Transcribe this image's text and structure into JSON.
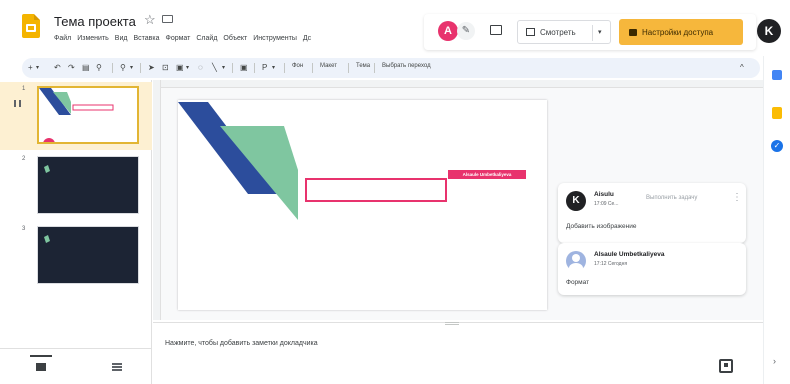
{
  "header": {
    "doc_title": "Тема проекта",
    "star_icon": "star-outline-icon",
    "folder_icon": "folder-icon",
    "menu": [
      "Файл",
      "Изменить",
      "Вид",
      "Вставка",
      "Формат",
      "Слайд",
      "Объект",
      "Инструменты",
      "Дс"
    ],
    "collab_avatar_letter": "A",
    "collab_avatar_color": "#e8336d",
    "present_label": "Смотреть",
    "share_label": "Настройки доступа",
    "share_color": "#f6b73c",
    "account_letter": "K"
  },
  "toolbar": {
    "background_label": "Фон",
    "theme_label": "Макет",
    "layout_label": "Тема",
    "transition_label": "Выбрать переход"
  },
  "filmstrip": {
    "slides": [
      {
        "number": "1"
      },
      {
        "number": "2"
      },
      {
        "number": "3"
      }
    ]
  },
  "canvas": {
    "user_tag": "Alsaule Umbetkaliyeva",
    "shape_colors": {
      "dark_blue": "#2c4d9c",
      "green": "#7fc6a0",
      "pink": "#e8336d"
    }
  },
  "comments": [
    {
      "avatar_letter": "K",
      "avatar_color": "#202124",
      "name": "Aisulu",
      "time": "17:09 Се...",
      "accept_label": "Выполнить задачу",
      "text": "Добавить изображение"
    },
    {
      "avatar_letter": "",
      "avatar_color": "#9fb4e0",
      "name": "Alsaule Umbetkaliyeva",
      "time": "17:12 Сегодня",
      "text": "Формат"
    }
  ],
  "notes": {
    "placeholder": "Нажмите, чтобы добавить заметки докладчика"
  }
}
